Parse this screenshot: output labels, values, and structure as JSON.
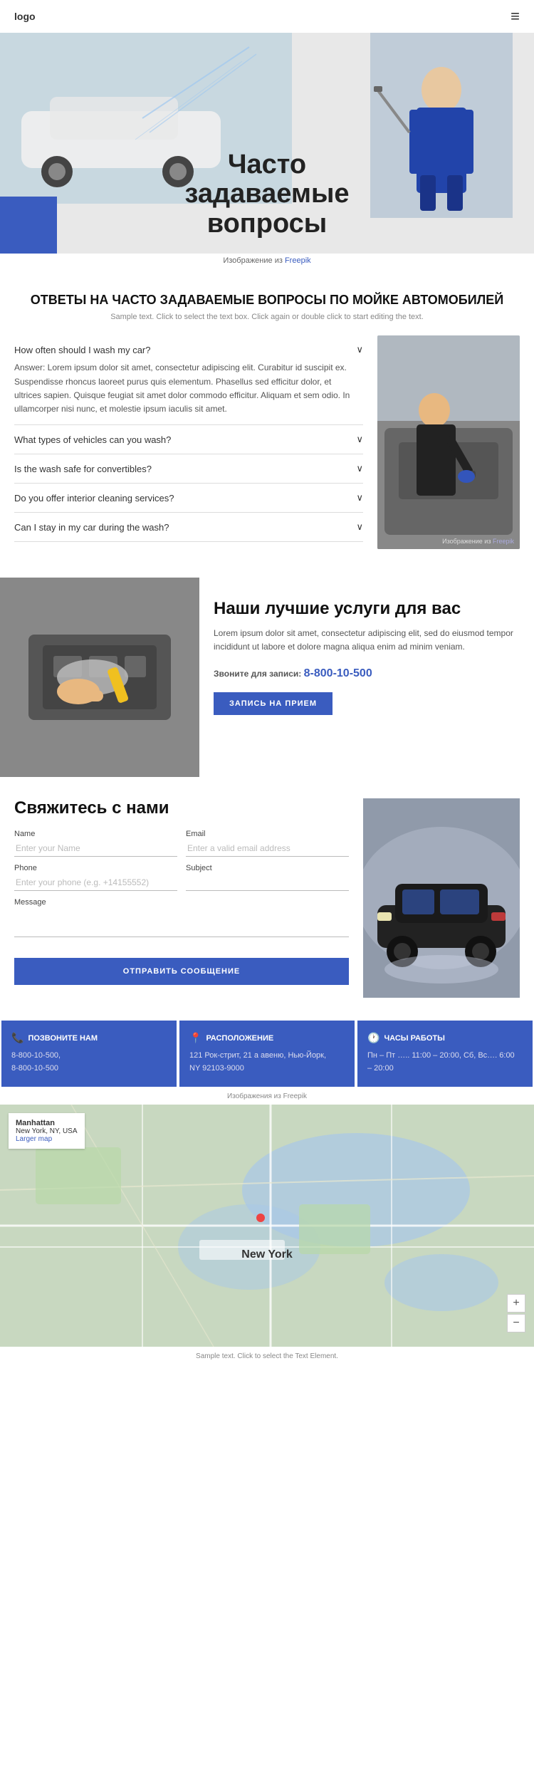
{
  "header": {
    "logo": "logo",
    "menu_icon": "≡"
  },
  "hero": {
    "title": "Часто задаваемые вопросы",
    "credit_text": "Изображение из",
    "credit_link": "Freepik"
  },
  "faq_section": {
    "title": "ОТВЕТЫ НА ЧАСТО ЗАДАВАЕМЫЕ ВОПРОСЫ ПО МОЙКЕ АВТОМОБИЛЕЙ",
    "subtitle": "Sample text. Click to select the text box. Click again or double click to start editing the text.",
    "image_credit_text": "Изображение из",
    "image_credit_link": "Freepik",
    "items": [
      {
        "question": "How often should I wash my car?",
        "answer": "Answer: Lorem ipsum dolor sit amet, consectetur adipiscing elit. Curabitur id suscipit ex. Suspendisse rhoncus laoreet purus quis elementum. Phasellus sed efficitur dolor, et ultrices sapien. Quisque feugiat sit amet dolor commodo efficitur. Aliquam et sem odio. In ullamcorper nisi nunc, et molestie ipsum iaculis sit amet.",
        "open": true
      },
      {
        "question": "What types of vehicles can you wash?",
        "answer": "",
        "open": false
      },
      {
        "question": "Is the wash safe for convertibles?",
        "answer": "",
        "open": false
      },
      {
        "question": "Do you offer interior cleaning services?",
        "answer": "",
        "open": false
      },
      {
        "question": "Can I stay in my car during the wash?",
        "answer": "",
        "open": false
      }
    ]
  },
  "services": {
    "title": "Наши лучшие услуги для вас",
    "description": "Lorem ipsum dolor sit amet, consectetur adipiscing elit, sed do eiusmod tempor incididunt ut labore et dolore magna aliqua enim ad minim veniam.",
    "phone_label": "Звоните для записи:",
    "phone": "8-800-10-500",
    "button_label": "ЗАПИСЬ НА ПРИЕМ"
  },
  "contact": {
    "title": "Свяжитесь с нами",
    "fields": {
      "name_label": "Name",
      "name_placeholder": "Enter your Name",
      "email_label": "Email",
      "email_placeholder": "Enter a valid email address",
      "phone_label": "Phone",
      "phone_placeholder": "Enter your phone (e.g. +14155552)",
      "subject_label": "Subject",
      "subject_placeholder": "",
      "message_label": "Message",
      "message_placeholder": ""
    },
    "submit_label": "ОТПРАВИТЬ СООБЩЕНИЕ"
  },
  "info_cards": [
    {
      "icon": "📞",
      "title": "ПОЗВОНИТЕ НАМ",
      "lines": [
        "8-800-10-500,",
        "8-800-10-500"
      ]
    },
    {
      "icon": "📍",
      "title": "РАСПОЛОЖЕНИЕ",
      "lines": [
        "121 Рок-стрит, 21 а авеню, Нью-Йорк,",
        "NY 92103-9000"
      ]
    },
    {
      "icon": "🕐",
      "title": "ЧАСЫ РАБОТЫ",
      "lines": [
        "Пн – Пт ….. 11:00 – 20:00, Сб, Вс…. 6:00",
        "– 20:00"
      ]
    }
  ],
  "info_cards_credit": "Изображения из Freepik",
  "map": {
    "address_city": "Manhattan",
    "address_line1": "New York, NY, USA",
    "city_label": "New York",
    "zoom_in": "+",
    "zoom_out": "−",
    "bottom_text": "Sample text. Click to select the Text Element."
  }
}
